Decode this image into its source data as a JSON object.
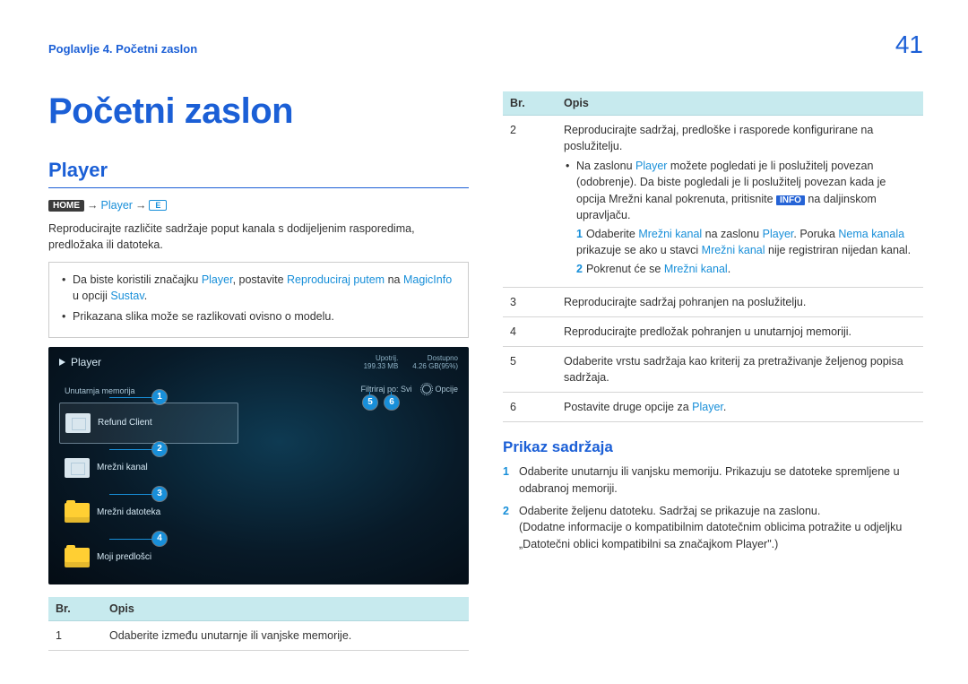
{
  "header": {
    "chapter": "Poglavlje 4. Početni zaslon",
    "page_number": "41"
  },
  "main": {
    "title": "Početni zaslon",
    "section": "Player",
    "path": {
      "home_badge": "HOME",
      "link": "Player",
      "enter": "E"
    },
    "intro": "Reproducirajte različite sadržaje poput kanala s dodijeljenim rasporedima, predložaka ili datoteka.",
    "note_items": [
      {
        "pre": "Da biste koristili značajku ",
        "l1": "Player",
        "mid1": ", postavite ",
        "l2": "Reproduciraj putem",
        "mid2": " na ",
        "l3": "MagicInfo",
        "mid3": " u opciji ",
        "l4": "Sustav",
        "post": "."
      },
      {
        "text": "Prikazana slika može se razlikovati ovisno o modelu."
      }
    ],
    "screenshot": {
      "title": "Player",
      "topright": [
        {
          "k": "Upotrij.",
          "v": "199.33 MB"
        },
        {
          "k": "Dostupno",
          "v": "4.26 GB(95%)"
        }
      ],
      "sidebar_label": "Unutarnja memorija",
      "items": [
        "Refund Client",
        "Mrežni kanal",
        "Mrežni datoteka",
        "Moji predlošci"
      ],
      "right_filter": "Filtriraj po: Svi",
      "right_options": "Opcije",
      "markers": {
        "m1": "1",
        "m2": "2",
        "m3": "3",
        "m4": "4",
        "m5": "5",
        "m6": "6"
      }
    },
    "table1": {
      "h1": "Br.",
      "h2": "Opis",
      "rows": [
        {
          "n": "1",
          "d": "Odaberite između unutarnje ili vanjske memorije."
        }
      ]
    }
  },
  "right": {
    "table2": {
      "h1": "Br.",
      "h2": "Opis",
      "row2": {
        "n": "2",
        "line1": "Reproducirajte sadržaj, predloške i rasporede konfigurirane na poslužitelju.",
        "bul1_pre": "Na zaslonu ",
        "bul1_link": "Player",
        "bul1_mid": " možete pogledati je li poslužitelj povezan (odobrenje). Da biste pogledali je li poslužitelj povezan kada je opcija Mrežni kanal pokrenuta, pritisnite ",
        "bul1_info": "INFO",
        "bul1_post": " na daljinskom upravljaču.",
        "s1_n": "1",
        "s1_pre": "Odaberite ",
        "s1_l1": "Mrežni kanal",
        "s1_mid": " na zaslonu ",
        "s1_l2": "Player",
        "s1_mid2": ". Poruka ",
        "s1_l3": "Nema kanala",
        "s1_mid3": " prikazuje se ako u stavci ",
        "s1_l4": "Mrežni kanal",
        "s1_post": " nije registriran nijedan kanal.",
        "s2_n": "2",
        "s2_pre": "Pokrenut će se ",
        "s2_l1": "Mrežni kanal",
        "s2_post": "."
      },
      "row3": {
        "n": "3",
        "d": "Reproducirajte sadržaj pohranjen na poslužitelju."
      },
      "row4": {
        "n": "4",
        "d": "Reproducirajte predložak pohranjen u unutarnjoj memoriji."
      },
      "row5": {
        "n": "5",
        "d": "Odaberite vrstu sadržaja kao kriterij za pretraživanje željenog popisa sadržaja."
      },
      "row6": {
        "n": "6",
        "d_pre": "Postavite druge opcije za ",
        "d_link": "Player",
        "d_post": "."
      }
    },
    "subhead": "Prikaz sadržaja",
    "ordered": [
      {
        "n": "1",
        "t": "Odaberite unutarnju ili vanjsku memoriju. Prikazuju se datoteke spremljene u odabranoj memoriji."
      },
      {
        "n": "2",
        "t": "Odaberite željenu datoteku. Sadržaj se prikazuje na zaslonu.",
        "extra": "(Dodatne informacije o kompatibilnim datotečnim oblicima potražite u odjeljku „Datotečni oblici kompatibilni sa značajkom Player\".)"
      }
    ]
  }
}
